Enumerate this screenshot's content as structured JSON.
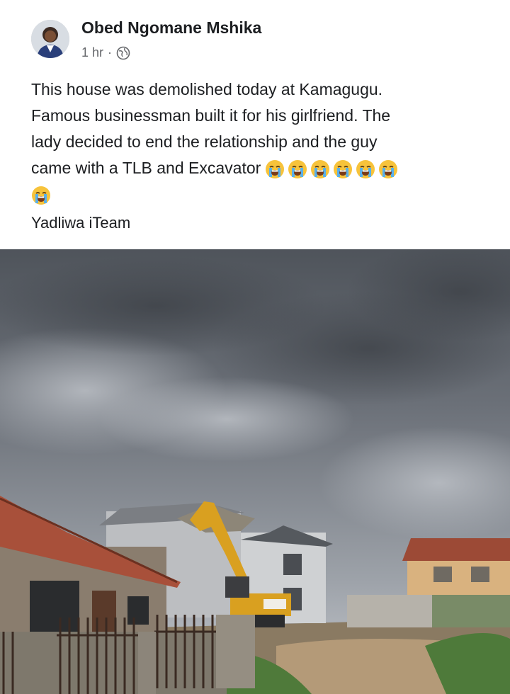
{
  "post": {
    "author": "Obed Ngomane Mshika",
    "time": "1 hr",
    "separator": "·",
    "privacy_icon": "globe-icon",
    "lines": [
      "This house was demolished today at Kamagugu.",
      "Famous businessman built it for his girlfriend. The",
      "lady decided to end the relationship and the guy",
      "came with a TLB and Excavator"
    ],
    "emoji_icon": "loudly-crying-face-icon",
    "emoji_count_line4": 6,
    "emoji_count_line5": 1,
    "tag": "Yadliwa iTeam"
  },
  "photo": {
    "description_icon": "demolition-photo",
    "sky_color": "#6b7078",
    "roof_color": "#b85a3f",
    "excavator_color": "#d9a020"
  }
}
